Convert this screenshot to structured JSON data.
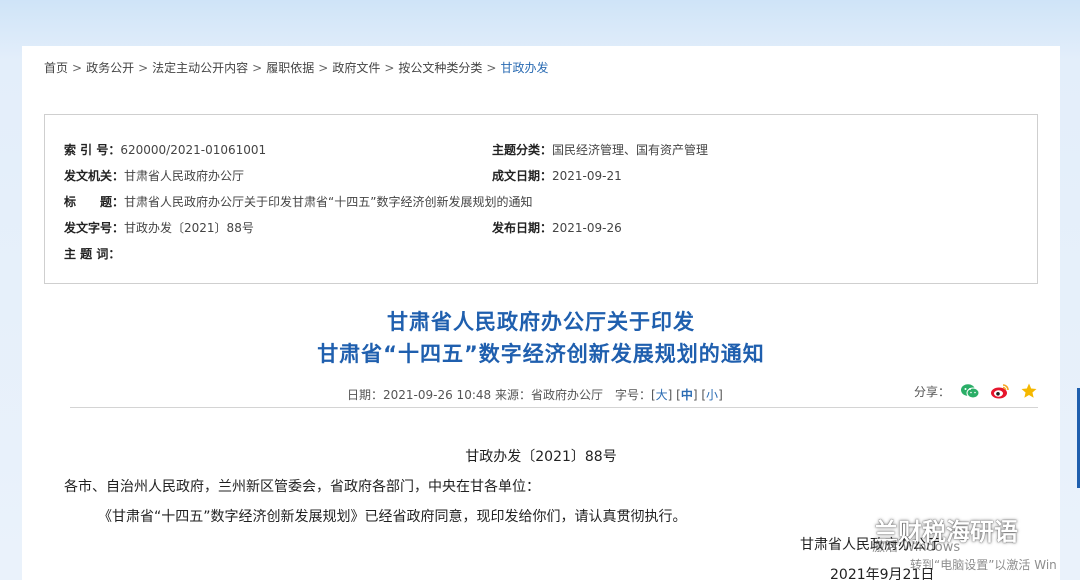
{
  "breadcrumb": [
    {
      "label": "首页"
    },
    {
      "label": "政务公开"
    },
    {
      "label": "法定主动公开内容"
    },
    {
      "label": "履职依据"
    },
    {
      "label": "政府文件"
    },
    {
      "label": "按公文种类分类"
    },
    {
      "label": "甘政办发"
    }
  ],
  "breadcrumb_sep": ">",
  "meta": {
    "index_label": "索 引 号：",
    "index_value": "620000/2021-01061001",
    "topic_label": "主题分类：",
    "topic_value": "国民经济管理、国有资产管理",
    "issuer_label": "发文机关：",
    "issuer_value": "甘肃省人民政府办公厅",
    "written_label": "成文日期：",
    "written_value": "2021-09-21",
    "title_label": "标　　题：",
    "title_value": "甘肃省人民政府办公厅关于印发甘肃省“十四五”数字经济创新发展规划的通知",
    "docno_label": "发文字号：",
    "docno_value": "甘政办发〔2021〕88号",
    "published_label": "发布日期：",
    "published_value": "2021-09-26",
    "keywords_label": "主 题 词：",
    "keywords_value": ""
  },
  "title": {
    "line1": "甘肃省人民政府办公厅关于印发",
    "line2": "甘肃省“十四五”数字经济创新发展规划的通知"
  },
  "info": {
    "prefix": "日期：2021-09-26 10:48 来源：省政府办公厅　字号：",
    "size_large": "大",
    "size_medium": "中",
    "size_small": "小",
    "share_label": "分享："
  },
  "body": {
    "doc_no": "甘政办发〔2021〕88号",
    "salutation": "各市、自治州人民政府，兰州新区管委会，省政府各部门，中央在甘各单位：",
    "paragraph": "《甘肃省“十四五”数字经济创新发展规划》已经省政府同意，现印发给你们，请认真贯彻执行。",
    "signature": "甘肃省人民政府办公厅",
    "date": "2021年9月21日"
  },
  "overlay": {
    "watermark_text": "兰财税海研语",
    "activation_line1": "激活 Windows",
    "activation_line2": "转到“电脑设置”以激活 Win"
  },
  "colors": {
    "accent": "#1f5fae",
    "link": "#2b6cb3",
    "wechat": "#2aae67",
    "weibo": "#e6162d",
    "star": "#f5b800"
  }
}
